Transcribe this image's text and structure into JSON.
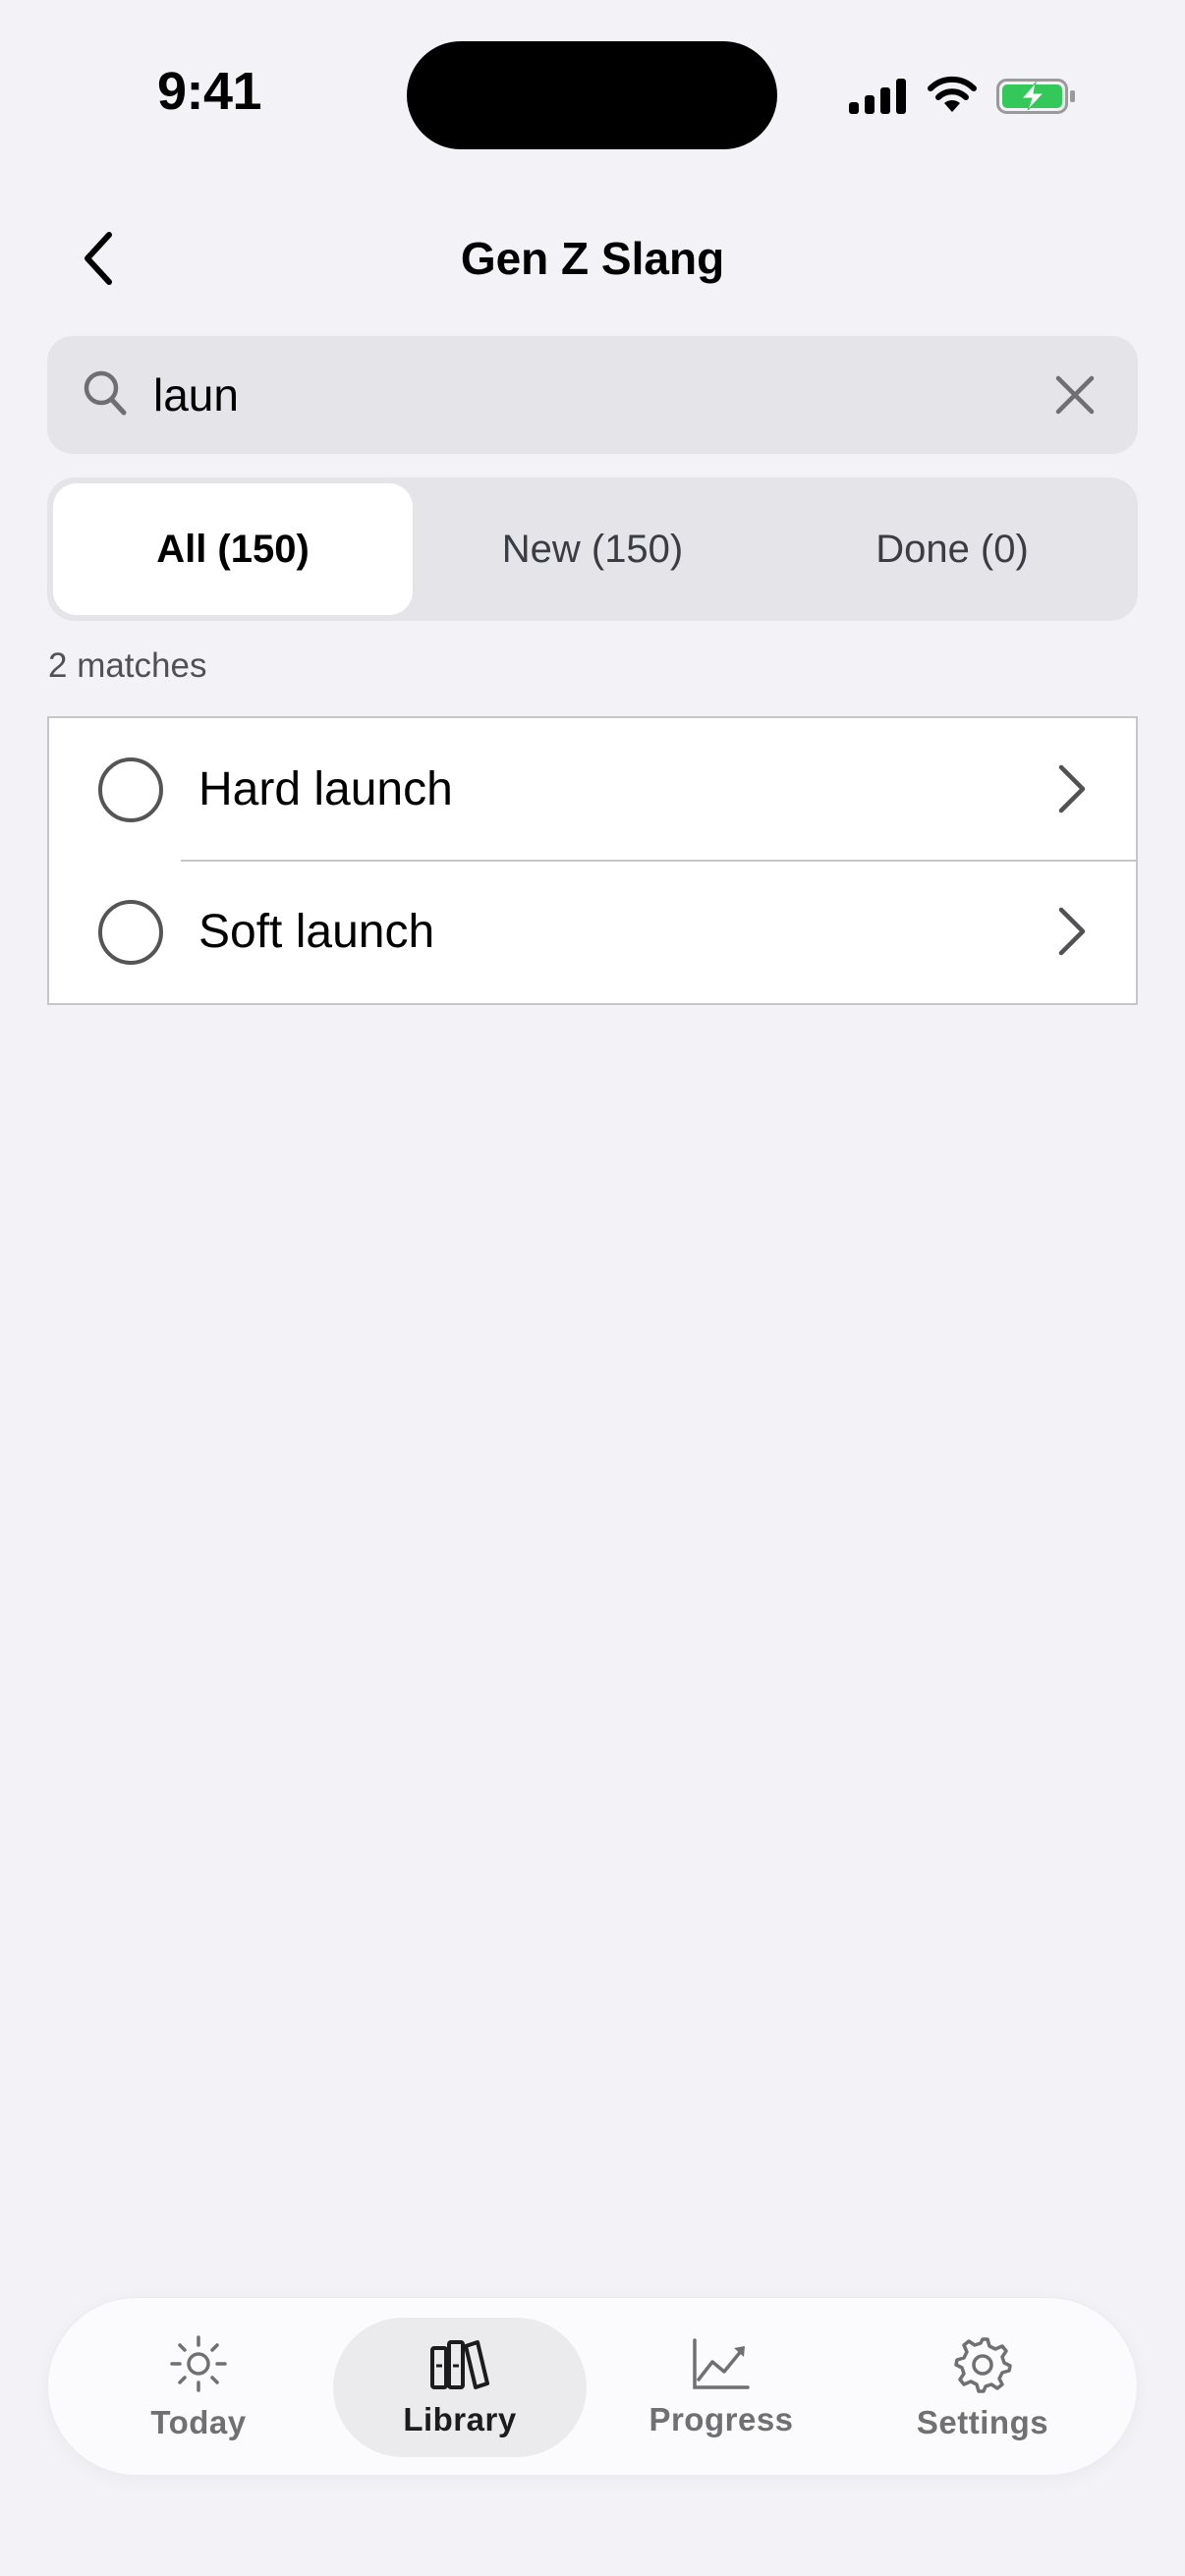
{
  "status_bar": {
    "time": "9:41",
    "icons": [
      "signal-icon",
      "wifi-icon",
      "battery-charging-icon"
    ],
    "battery_color": "#34c759"
  },
  "nav": {
    "title": "Gen Z Slang",
    "back_icon": "chevron-left-icon"
  },
  "search": {
    "value": "laun",
    "icon": "search-icon",
    "clear_icon": "close-icon"
  },
  "segments": [
    {
      "label": "All (150)",
      "selected": true
    },
    {
      "label": "New (150)",
      "selected": false
    },
    {
      "label": "Done (0)",
      "selected": false
    }
  ],
  "results": {
    "count_text": "2 matches",
    "items": [
      {
        "label": "Hard launch",
        "checked": false
      },
      {
        "label": "Soft launch",
        "checked": false
      }
    ]
  },
  "tab_bar": {
    "tabs": [
      {
        "label": "Today",
        "icon": "sun-icon",
        "selected": false
      },
      {
        "label": "Library",
        "icon": "books-icon",
        "selected": true
      },
      {
        "label": "Progress",
        "icon": "chart-line-icon",
        "selected": false
      },
      {
        "label": "Settings",
        "icon": "gear-icon",
        "selected": false
      }
    ]
  }
}
